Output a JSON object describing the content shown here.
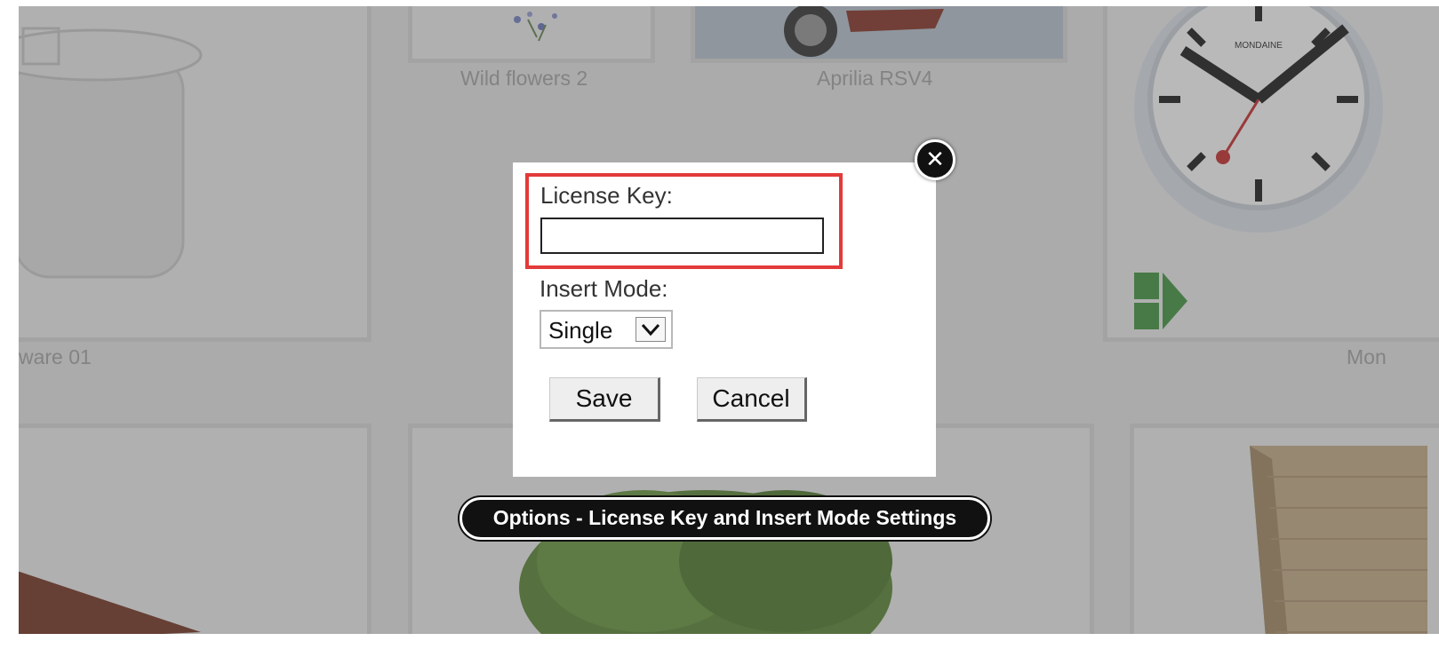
{
  "gallery": {
    "captions": {
      "flowers": "Wild flowers 2",
      "motorbike": "Aprilia RSV4",
      "cookware": "ware 01",
      "clock": "Mon"
    },
    "clock_brand": "MONDAINE"
  },
  "dialog": {
    "license_label": "License Key:",
    "license_value": "",
    "insert_mode_label": "Insert Mode:",
    "insert_mode_value": "Single",
    "save_label": "Save",
    "cancel_label": "Cancel",
    "close_icon": "close-icon"
  },
  "tooltip": {
    "text": "Options - License Key and Insert Mode Settings"
  },
  "colors": {
    "highlight": "#e33a3a",
    "next_arrow": "#4a9a4a",
    "tooltip_bg": "#111111"
  }
}
